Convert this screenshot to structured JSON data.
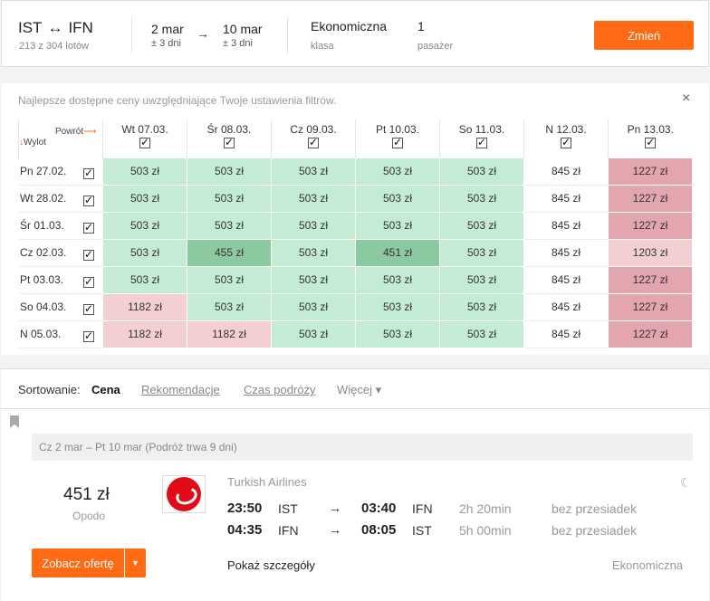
{
  "header": {
    "origin": "IST",
    "destination": "IFN",
    "route_arrow": "↔",
    "flights_count": "213 z 304 lotów",
    "depart_date": "2 mar",
    "depart_flex": "± 3 dni",
    "return_date": "10 mar",
    "return_flex": "± 3 dni",
    "date_arrow": "→",
    "cabin_class": "Ekonomiczna",
    "cabin_label": "klasa",
    "passengers": "1",
    "passengers_label": "pasażer",
    "change_button": "Zmień"
  },
  "matrix": {
    "notice": "Najlepsze dostępne ceny uwzględniające Twoje ustawienia filtrów.",
    "close_icon": "×",
    "return_label": "Powrót",
    "departure_label": "Wylot",
    "columns": [
      "Wt 07.03.",
      "Śr 08.03.",
      "Cz 09.03.",
      "Pt 10.03.",
      "So 11.03.",
      "N 12.03.",
      "Pn 13.03."
    ],
    "rows": [
      {
        "label": "Pn 27.02.",
        "cells": [
          [
            "503 zł",
            "g"
          ],
          [
            "503 zł",
            "g"
          ],
          [
            "503 zł",
            "g"
          ],
          [
            "503 zł",
            "g"
          ],
          [
            "503 zł",
            "g"
          ],
          [
            "845 zł",
            "w"
          ],
          [
            "1227 zł",
            "dp"
          ]
        ]
      },
      {
        "label": "Wt 28.02.",
        "cells": [
          [
            "503 zł",
            "g"
          ],
          [
            "503 zł",
            "g"
          ],
          [
            "503 zł",
            "g"
          ],
          [
            "503 zł",
            "g"
          ],
          [
            "503 zł",
            "g"
          ],
          [
            "845 zł",
            "w"
          ],
          [
            "1227 zł",
            "dp"
          ]
        ]
      },
      {
        "label": "Śr 01.03.",
        "cells": [
          [
            "503 zł",
            "g"
          ],
          [
            "503 zł",
            "g"
          ],
          [
            "503 zł",
            "g"
          ],
          [
            "503 zł",
            "g"
          ],
          [
            "503 zł",
            "g"
          ],
          [
            "845 zł",
            "w"
          ],
          [
            "1227 zł",
            "dp"
          ]
        ]
      },
      {
        "label": "Cz 02.03.",
        "cells": [
          [
            "503 zł",
            "g"
          ],
          [
            "455 zł",
            "dg"
          ],
          [
            "503 zł",
            "g"
          ],
          [
            "451 zł",
            "dg"
          ],
          [
            "503 zł",
            "g"
          ],
          [
            "845 zł",
            "w"
          ],
          [
            "1203 zł",
            "p"
          ]
        ]
      },
      {
        "label": "Pt 03.03.",
        "cells": [
          [
            "503 zł",
            "g"
          ],
          [
            "503 zł",
            "g"
          ],
          [
            "503 zł",
            "g"
          ],
          [
            "503 zł",
            "g"
          ],
          [
            "503 zł",
            "g"
          ],
          [
            "845 zł",
            "w"
          ],
          [
            "1227 zł",
            "dp"
          ]
        ]
      },
      {
        "label": "So 04.03.",
        "cells": [
          [
            "1182 zł",
            "p"
          ],
          [
            "503 zł",
            "g"
          ],
          [
            "503 zł",
            "g"
          ],
          [
            "503 zł",
            "g"
          ],
          [
            "503 zł",
            "g"
          ],
          [
            "845 zł",
            "w"
          ],
          [
            "1227 zł",
            "dp"
          ]
        ]
      },
      {
        "label": "N 05.03.",
        "cells": [
          [
            "1182 zł",
            "p"
          ],
          [
            "1182 zł",
            "p"
          ],
          [
            "503 zł",
            "g"
          ],
          [
            "503 zł",
            "g"
          ],
          [
            "503 zł",
            "g"
          ],
          [
            "845 zł",
            "w"
          ],
          [
            "1227 zł",
            "dp"
          ]
        ]
      }
    ]
  },
  "sort": {
    "label": "Sortowanie:",
    "current": "Cena",
    "options": [
      "Rekomendacje",
      "Czas podróży"
    ],
    "more": "Więcej ▾"
  },
  "result": {
    "trip_summary": "Cz 2 mar – Pt 10 mar  (Podróż trwa 9 dni)",
    "price": "451 zł",
    "provider": "Opodo",
    "airline": "Turkish Airlines",
    "night_icon": "☾",
    "legs": [
      {
        "dep_time": "23:50",
        "dep_airport": "IST",
        "arrow": "→",
        "arr_time": "03:40",
        "arr_airport": "IFN",
        "duration": "2h 20min",
        "stops": "bez przesiadek"
      },
      {
        "dep_time": "04:35",
        "dep_airport": "IFN",
        "arrow": "→",
        "arr_time": "08:05",
        "arr_airport": "IST",
        "duration": "5h 00min",
        "stops": "bez przesiadek"
      }
    ],
    "offer_button": "Zobacz ofertę",
    "offer_dropdown": "▼",
    "details_link": "Pokaż szczegóły",
    "cabin": "Ekonomiczna"
  }
}
